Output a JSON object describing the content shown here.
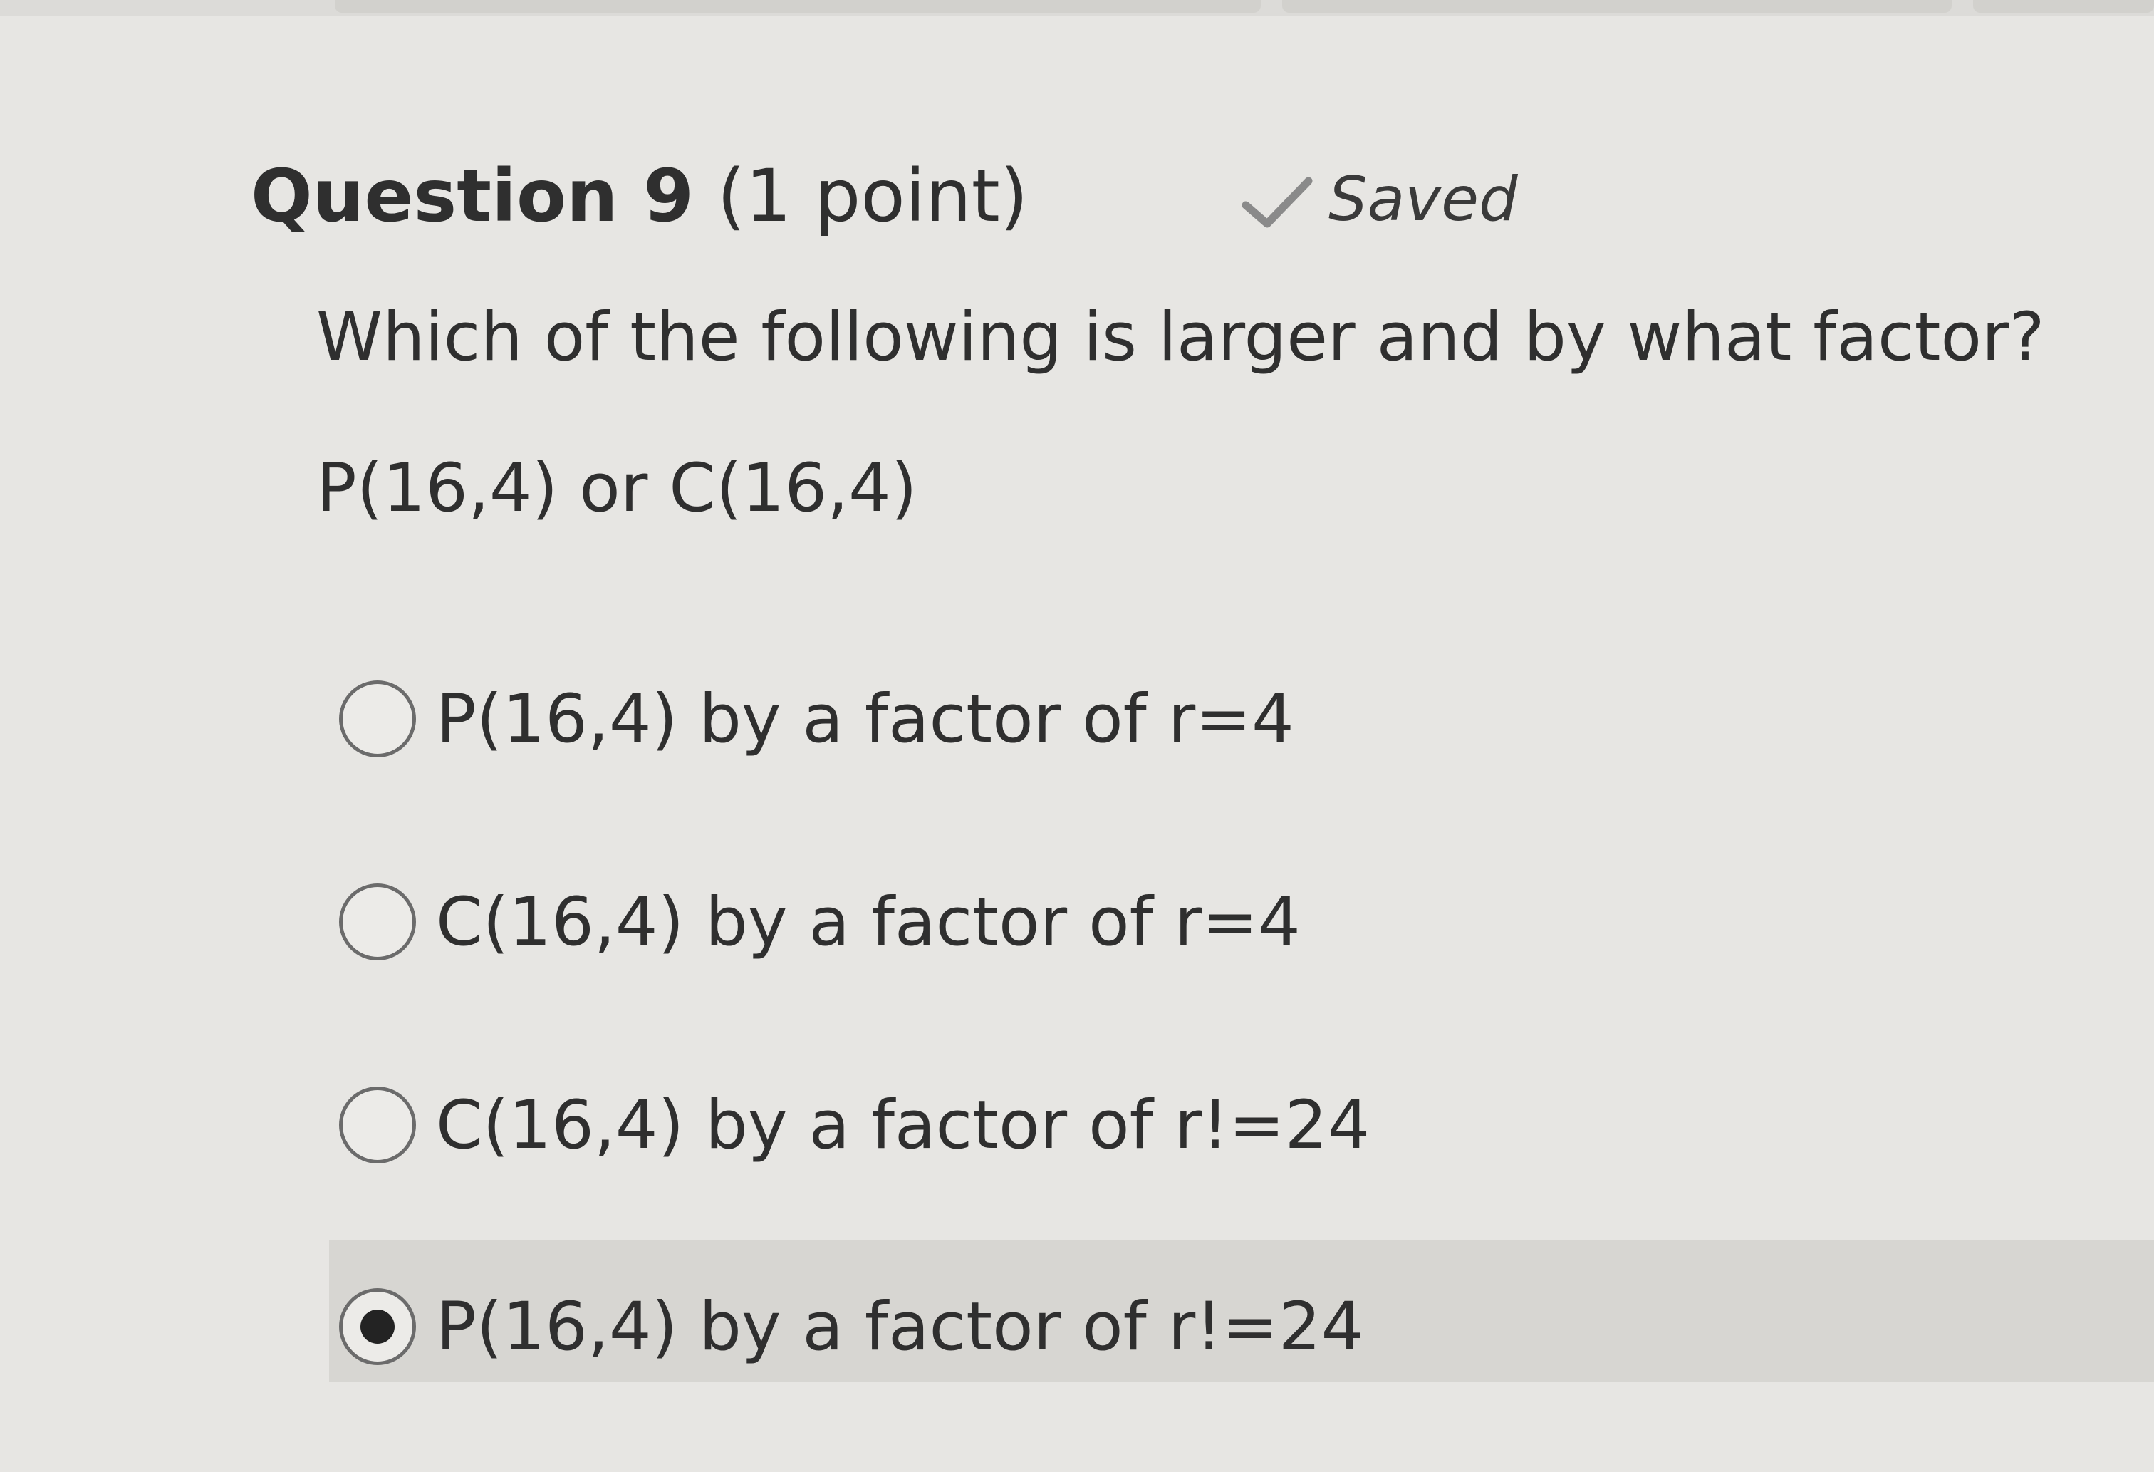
{
  "question": {
    "number_label": "Question 9",
    "points_label": "(1 point)",
    "status_label": "Saved",
    "status_icon": "checkmark-icon",
    "prompt": "Which of the following is larger and by what factor?",
    "expression": "P(16,4) or C(16,4)"
  },
  "options": [
    {
      "label": "P(16,4) by a factor of r=4",
      "selected": false
    },
    {
      "label": "C(16,4) by a factor of r=4",
      "selected": false
    },
    {
      "label": "C(16,4) by a factor of r!=24",
      "selected": false
    },
    {
      "label": "P(16,4) by a factor of r!=24",
      "selected": true
    }
  ],
  "colors": {
    "page_background": "#e7e6e3",
    "selected_row_background": "#d7d6d2",
    "text": "#2f2f2f",
    "checkmark": "#8a8a8a"
  }
}
